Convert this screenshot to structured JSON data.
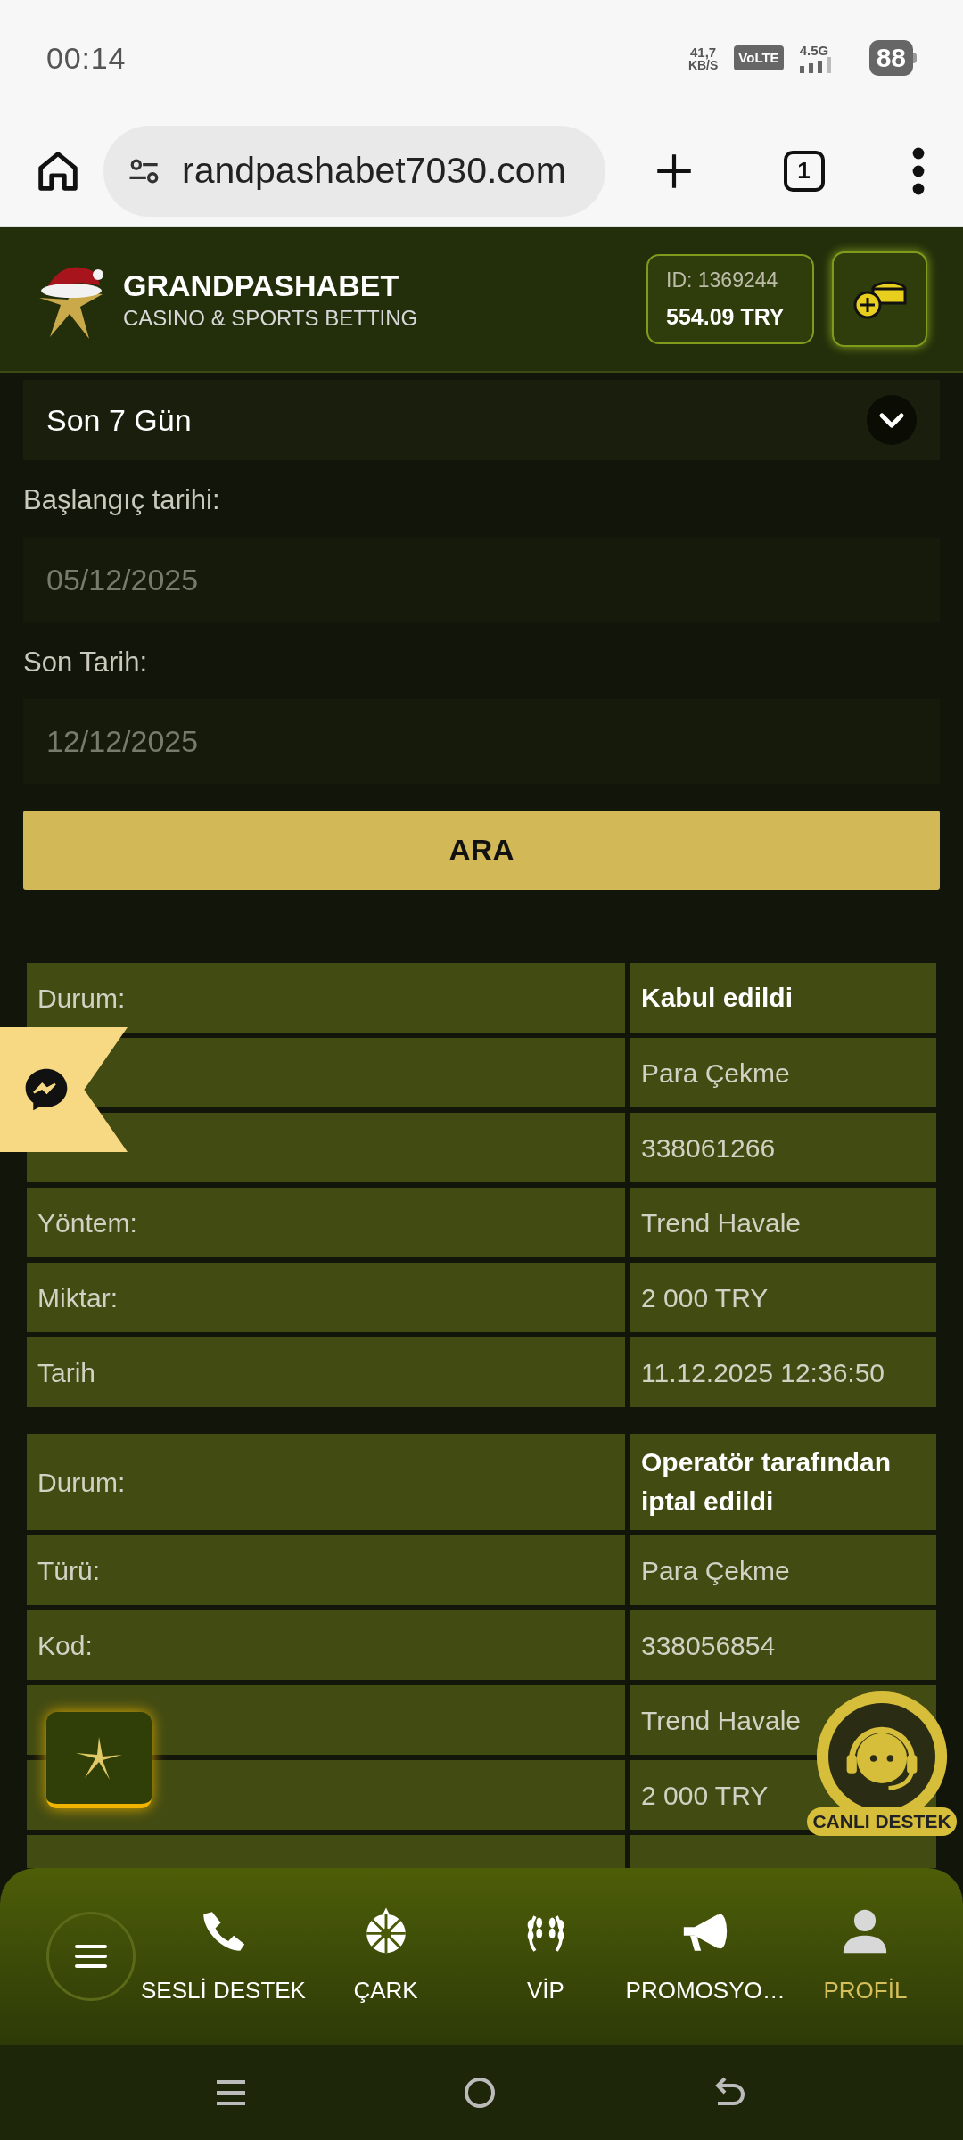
{
  "status_bar": {
    "time": "00:14",
    "speed": "41,7",
    "speed_unit": "KB/S",
    "volte": "VoLTE",
    "network": "4.5G",
    "battery": "88"
  },
  "browser": {
    "url": "randpashabet7030.com",
    "tab_count": "1"
  },
  "header": {
    "brand": "GRANDPASHABET",
    "tagline": "CASINO & SPORTS BETTING",
    "account_id": "ID: 1369244",
    "balance": "554.09 TRY"
  },
  "filter": {
    "period": "Son 7 Gün",
    "start_label": "Başlangıç tarihi:",
    "start_placeholder": "05/12/2025",
    "end_label": "Son Tarih:",
    "end_placeholder": "12/12/2025",
    "search_button": "ARA"
  },
  "transactions": [
    {
      "rows": [
        {
          "kind": "status",
          "label": "Durum:",
          "value": "Kabul edildi"
        },
        {
          "kind": "field",
          "value": "Para Çekme"
        },
        {
          "kind": "field",
          "value": "338061266"
        },
        {
          "kind": "field",
          "label": "Yöntem:",
          "value": "Trend Havale"
        },
        {
          "kind": "field",
          "label": "Miktar:",
          "value": "2 000 TRY"
        },
        {
          "kind": "field",
          "label": "Tarih",
          "value": "11.12.2025 12:36:50"
        }
      ]
    },
    {
      "rows": [
        {
          "kind": "status",
          "label": "Durum:",
          "value": "Operatör tarafından iptal edildi"
        },
        {
          "kind": "field",
          "label": "Türü:",
          "value": "Para Çekme"
        },
        {
          "kind": "field",
          "label": "Kod:",
          "value": "338056854"
        },
        {
          "kind": "field",
          "value": "Trend Havale"
        },
        {
          "kind": "field",
          "value": "2 000 TRY"
        },
        {
          "kind": "field"
        }
      ]
    }
  ],
  "live_support": {
    "label": "CANLI DESTEK"
  },
  "bottom_nav": [
    {
      "kind": "menu",
      "selected": false
    },
    {
      "kind": "phone",
      "label": "SESLİ DESTEK",
      "selected": false
    },
    {
      "kind": "wheel",
      "label": "ÇARK",
      "selected": false
    },
    {
      "kind": "vip",
      "label": "VİP",
      "selected": false
    },
    {
      "kind": "promo",
      "label": "PROMOSYO…",
      "selected": false
    },
    {
      "kind": "profile",
      "label": "PROFİL",
      "selected": true
    }
  ]
}
